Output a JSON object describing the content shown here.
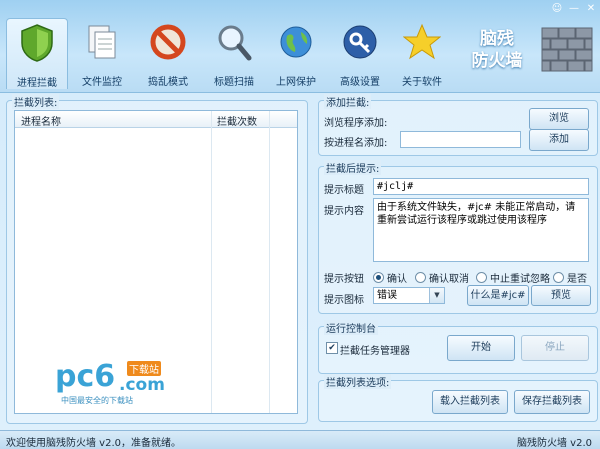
{
  "window": {
    "controls": [
      "☺",
      "—",
      "✕"
    ]
  },
  "brand": {
    "line1": "脑残",
    "line2": "防火墙"
  },
  "tabs": [
    {
      "label": "进程拦截",
      "icon": "shield-icon",
      "active": true
    },
    {
      "label": "文件监控",
      "icon": "files-icon",
      "active": false
    },
    {
      "label": "捣乱模式",
      "icon": "forbidden-icon",
      "active": false
    },
    {
      "label": "标题扫描",
      "icon": "magnifier-icon",
      "active": false
    },
    {
      "label": "上网保护",
      "icon": "globe-icon",
      "active": false
    },
    {
      "label": "高级设置",
      "icon": "key-icon",
      "active": false
    },
    {
      "label": "关于软件",
      "icon": "star-icon",
      "active": false
    }
  ],
  "left": {
    "title": "拦截列表:",
    "columns": [
      "进程名称",
      "拦截次数"
    ],
    "rows": [],
    "watermark": {
      "logo": "pc6",
      "com": ".com",
      "badge": "下载站",
      "slogan": "中国最安全的下载站"
    }
  },
  "add": {
    "title": "添加拦截:",
    "browse_label": "浏览程序添加:",
    "browse_btn": "浏览",
    "byname_label": "按进程名添加:",
    "byname_value": "",
    "add_btn": "添加"
  },
  "prompt": {
    "title": "拦截后提示:",
    "title_label": "提示标题",
    "title_value": "#jclj#",
    "content_label": "提示内容",
    "content_value": "由于系统文件缺失，#jc# 未能正常启动，请重新尝试运行该程序或跳过使用该程序",
    "button_label": "提示按钮",
    "radios": [
      "确认",
      "确认取消",
      "中止重试忽略",
      "是否"
    ],
    "radio_selected": 0,
    "icon_label": "提示图标",
    "icon_value": "错误",
    "what_btn": "什么是#jc#",
    "preview_btn": "预览"
  },
  "console": {
    "title": "运行控制台",
    "checkbox_label": "拦截任务管理器",
    "checked": true,
    "start_btn": "开始",
    "stop_btn": "停止"
  },
  "listopts": {
    "title": "拦截列表选项:",
    "load_btn": "载入拦截列表",
    "save_btn": "保存拦截列表"
  },
  "status": {
    "left": "欢迎使用脑残防火墙 v2.0，准备就绪。",
    "right": "脑残防火墙 v2.0"
  }
}
